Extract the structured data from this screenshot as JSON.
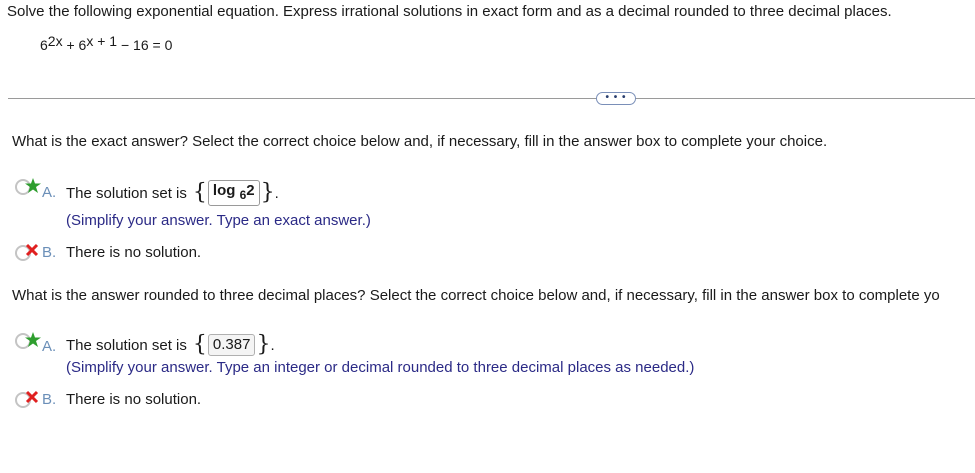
{
  "prompt": "Solve the following exponential equation. Express irrational solutions in exact form and as a decimal rounded to three decimal places.",
  "equation": {
    "base1": "6",
    "exp1": "2x",
    "plus": "+ 6",
    "exp2": "x + 1",
    "rest": "− 16 = 0"
  },
  "more_button": "• • •",
  "part1": {
    "question": "What is the exact answer? Select the correct choice below and, if necessary, fill in the answer box to complete your choice.",
    "choice_a": {
      "letter": "A.",
      "text": "The solution set is",
      "answer_log": "log",
      "answer_base": "6",
      "answer_arg": "2",
      "hint": "(Simplify your answer. Type an exact answer.)"
    },
    "choice_b": {
      "letter": "B.",
      "text": "There is no solution."
    }
  },
  "part2": {
    "question": "What is the answer rounded to three decimal places? Select the correct choice below and, if necessary, fill in the answer box to complete yo",
    "choice_a": {
      "letter": "A.",
      "text": "The solution set is",
      "answer": "0.387",
      "hint": "(Simplify your answer. Type an integer or decimal rounded to three decimal places as needed.)"
    },
    "choice_b": {
      "letter": "B.",
      "text": "There is no solution."
    }
  },
  "icons": {
    "correct": "star-correct-icon",
    "incorrect": "x-incorrect-icon",
    "star_color": "#2e9e2e",
    "x_color": "#e02020",
    "radio_color": "#c4c4c4"
  }
}
